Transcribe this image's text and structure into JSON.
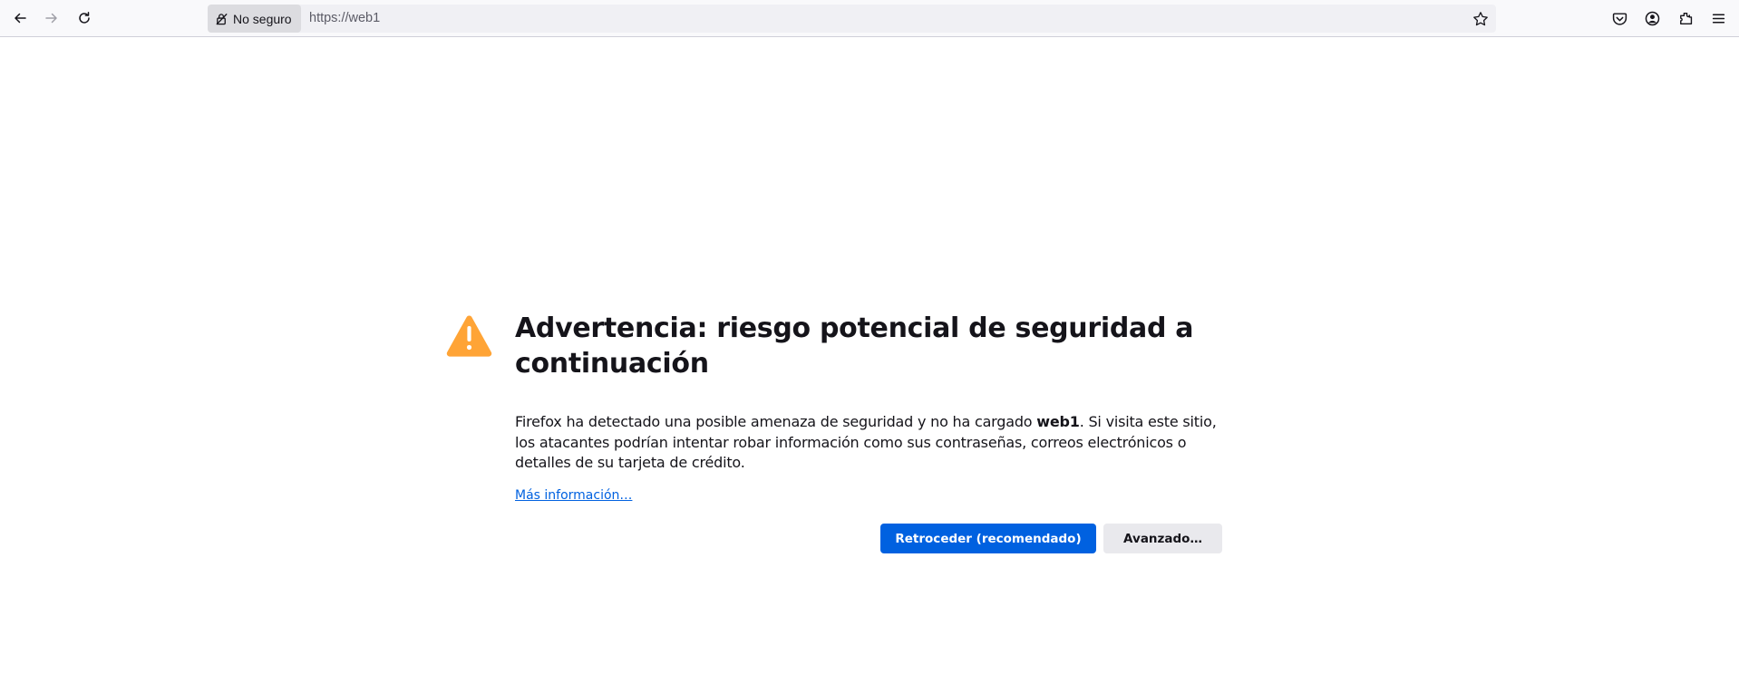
{
  "browser": {
    "nav": {
      "back_icon": "arrow-left-icon",
      "forward_icon": "arrow-right-icon",
      "reload_icon": "reload-icon"
    },
    "urlbar": {
      "security_label": "No seguro",
      "security_icon": "insecure-lock-icon",
      "url": "https://web1",
      "bookmark_icon": "star-icon"
    },
    "toolbar_icons": [
      "pocket-icon",
      "account-icon",
      "extensions-icon",
      "menu-icon"
    ]
  },
  "error_page": {
    "title": "Advertencia: riesgo potencial de seguridad a continuación",
    "description_before": "Firefox ha detectado una posible amenaza de seguridad y no ha cargado ",
    "description_host": "web1",
    "description_after": ". Si visita este sitio, los atacantes podrían intentar robar información como sus contraseñas, correos electrónicos o detalles de su tarjeta de crédito.",
    "learn_more_label": "Más información…",
    "go_back_label": "Retroceder (recomendado)",
    "advanced_label": "Avanzado…",
    "warning_icon": "warning-triangle-icon"
  },
  "colors": {
    "primary_button": "#0061e0",
    "secondary_button": "#e9e9ed",
    "warning": "#ffa436",
    "link": "#0061e0"
  }
}
